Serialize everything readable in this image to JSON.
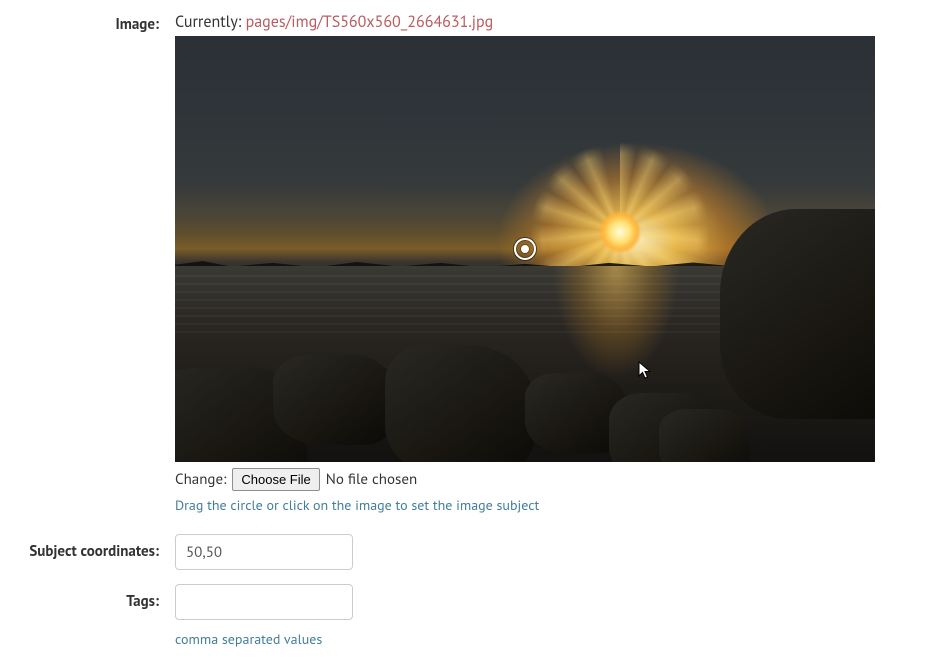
{
  "image_field": {
    "label": "Image:",
    "currently_prefix": "Currently: ",
    "current_path": "pages/img/TS560x560_2664631.jpg",
    "change_label": "Change:",
    "choose_button": "Choose File",
    "no_file": "No file chosen",
    "help_text": "Drag the circle or click on the image to set the image subject"
  },
  "subject_coords": {
    "label": "Subject coordinates:",
    "value": "50,50"
  },
  "tags": {
    "label": "Tags:",
    "value": "",
    "help_text": "comma separated values"
  }
}
